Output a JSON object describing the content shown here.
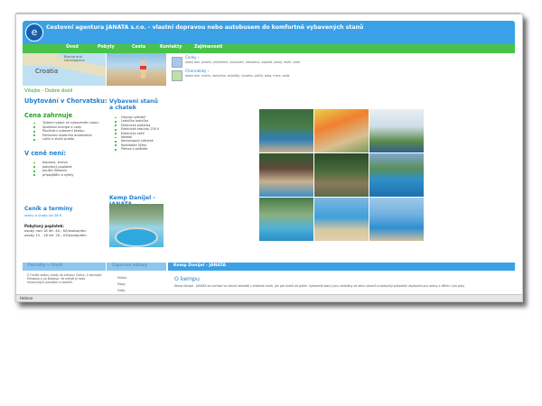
{
  "header": {
    "title": "Cestovní agentura JANATA s.r.o. - vlastní dopravou nebo autobusem do komfortně vybavených stanů"
  },
  "menu": [
    "Úvod",
    "Pobyty",
    "Cesta",
    "Kontakty",
    "Zajímavosti"
  ],
  "map": {
    "label": "Croatia",
    "caption": "Bosnia and Herzegovina"
  },
  "left": {
    "welcome": "Vítejte - Dobré došli",
    "heading1": "Ubytování v Chorvatsku:",
    "heading2": "Cena zahrnuje",
    "includes": [
      "Týdenní pobyt ve vybaveném stanu",
      "Spotřebu energie a vody",
      "Používání vybavení kempu",
      "Parkování osobního automobilu",
      "Ložní a stolní prádlo"
    ],
    "heading3": "V ceně není:",
    "excludes": [
      "doprava, strava",
      "pobytový poplatek",
      "použití lůžkovin",
      "připojištění a výlety"
    ],
    "price_heading": "Ceník a termíny",
    "price_line": "stany a chaty od 28 €",
    "fee_title": "Pobytový poplatek:",
    "fee_line1": "osoby nad 18 let: 40,- Kč/osoba/den",
    "fee_line2": "osoby 12 - 18 let: 20,- Kč/osoba/den"
  },
  "middle": {
    "heading": "Vybavení stanů a chatek",
    "items": [
      "Obývací předsíň",
      "Lednička lednička",
      "Elektrická plotýnka",
      "Elektrické zásuvky 230 V",
      "Elektrický vařič",
      "Nádobí",
      "Kempingový nábytek",
      "Rozkládací lůžko",
      "Přehoz a polštáře"
    ],
    "camp_heading": "Kemp Danijel - JANATA"
  },
  "right": {
    "item1_title": "Česky ›",
    "item1_text": "dobrý den, prosím, přijedeme, ubytování, obsazeno, zaplatit, pokoj, moře, voda",
    "item2_title": "Chorvatsky ›",
    "item2_text": "dobar dan, molim, dolazimo, smještaj, zauzeto, platiti, soba, more, voda"
  },
  "bottom": {
    "bar_left": "Památky v Omiši",
    "bar_middle": "Zajímavé odkazy",
    "bar_right": "Kemp Danijel - JANATA",
    "left_text": "Z Omiše vedou výlety do kaňonu Cetiny, k pevnosti Mirabela a na Biokovo. Ve městě je řada historických památek a kostelů.",
    "links": [
      "Počasí",
      "Mapy",
      "Fotky"
    ],
    "okempu": "O kempu",
    "right_text": "Kemp Danijel - JANATA se nachází ve stinné zahradě v blízkosti moře, jen pár kroků od pláže. Vybavené stany jsou umístěny ve stínu stromů a poskytují pohodlné ubytování pro rodiny s dětmi i pro páry."
  },
  "status": {
    "text": "Hotovo"
  },
  "colors": {
    "header_blue": "#3ba1e6",
    "menu_green": "#49c24a",
    "heading_blue": "#1e7fd0",
    "bar_blue": "#8fc6ee"
  }
}
